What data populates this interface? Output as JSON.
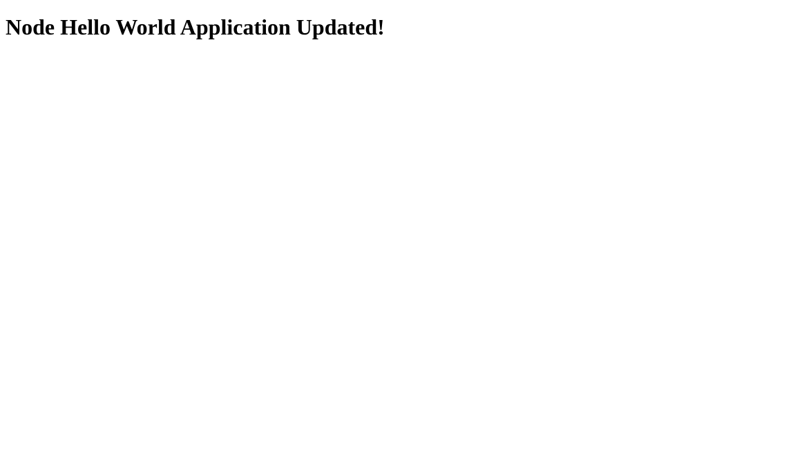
{
  "heading": "Node Hello World Application Updated!"
}
